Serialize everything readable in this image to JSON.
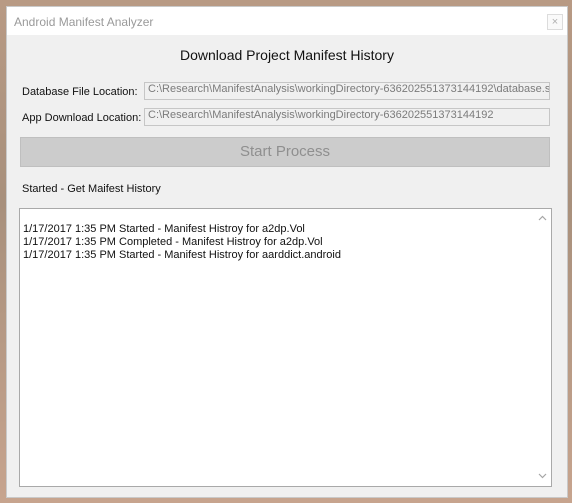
{
  "window": {
    "title": "Android Manifest Analyzer",
    "close_glyph": "×"
  },
  "heading": "Download Project Manifest History",
  "fields": {
    "database_label": "Database File Location:",
    "database_value": "C:\\Research\\ManifestAnalysis\\workingDirectory-636202551373144192\\database.sc",
    "app_label": "App Download Location:",
    "app_value": "C:\\Research\\ManifestAnalysis\\workingDirectory-636202551373144192"
  },
  "start_button": "Start Process",
  "status_text": "Started - Get Maifest History",
  "log_lines": [
    "1/17/2017 1:35 PM Started - Manifest Histroy for a2dp.Vol",
    "1/17/2017 1:35 PM Completed - Manifest Histroy for a2dp.Vol",
    "1/17/2017 1:35 PM Started - Manifest Histroy for aarddict.android"
  ],
  "icons": {
    "scroll_up": "chevron-up-icon",
    "scroll_down": "chevron-down-icon"
  }
}
